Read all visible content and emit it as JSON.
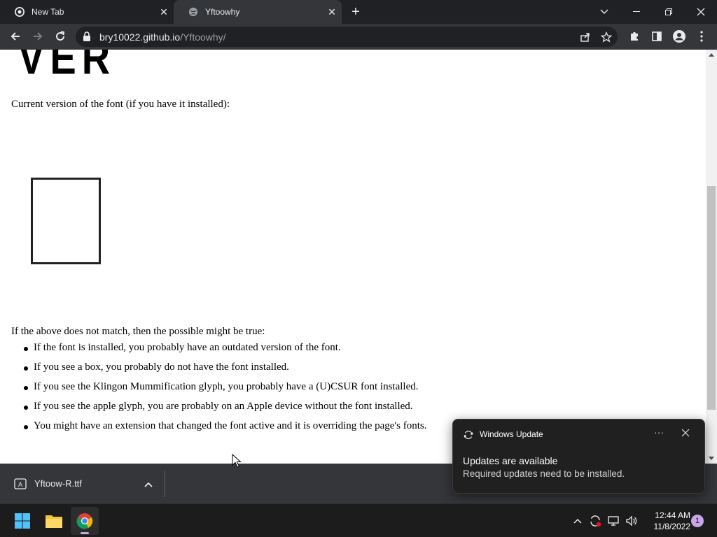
{
  "browser": {
    "tabs": [
      {
        "title": "New Tab",
        "active": false
      },
      {
        "title": "Yftoowhy",
        "active": true
      }
    ],
    "address": {
      "host": "bry10022.github.io",
      "path": "/Yftoowhy/"
    }
  },
  "page": {
    "heading_fragment": "VER",
    "current_version_text": "Current version of the font (if you have it installed):",
    "mismatch_intro": "If the above does not match, then the possible might be true:",
    "bullets": [
      "If the font is installed, you probably have an outdated version of the font.",
      "If you see a box, you probably do not have the font installed.",
      "If you see the Klingon Mummification glyph, you probably have a (U)CSUR font installed.",
      "If you see the apple glyph, you are probably on an Apple device without the font installed.",
      "You might have an extension that changed the font active and it is overriding the page's fonts."
    ]
  },
  "download_shelf": {
    "file_name": "Yftoow-R.ttf"
  },
  "toast": {
    "app": "Windows Update",
    "title": "Updates are available",
    "body": "Required updates need to be installed."
  },
  "taskbar": {
    "time": "12:44 AM",
    "date": "11/8/2022",
    "notification_count": "1"
  },
  "colors": {
    "accent": "#c7a6e9",
    "chrome_dark": "#202124",
    "chrome_toolbar": "#35363a"
  }
}
